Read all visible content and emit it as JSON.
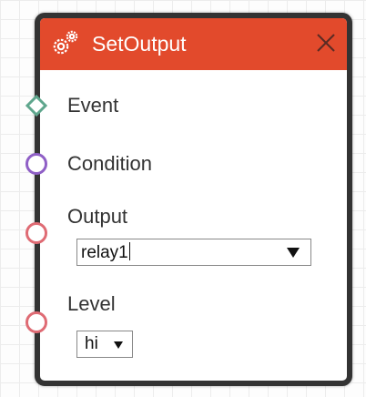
{
  "node": {
    "title": "SetOutput",
    "header_color": "#e24a2c",
    "border_color": "#333333",
    "icon": "gears-icon",
    "close_icon": "close-icon"
  },
  "ports": {
    "event": {
      "label": "Event",
      "color": "#5fa68d",
      "shape": "diamond"
    },
    "condition": {
      "label": "Condition",
      "color": "#8f5fc6",
      "shape": "circle"
    },
    "output": {
      "label": "Output",
      "color": "#df6b74",
      "shape": "circle"
    },
    "level": {
      "label": "Level",
      "color": "#df6b74",
      "shape": "circle"
    }
  },
  "fields": {
    "output": {
      "value": "relay1",
      "arrow_icon": "dropdown-arrow-icon"
    },
    "level": {
      "value": "hi",
      "arrow_icon": "dropdown-arrow-icon"
    }
  }
}
